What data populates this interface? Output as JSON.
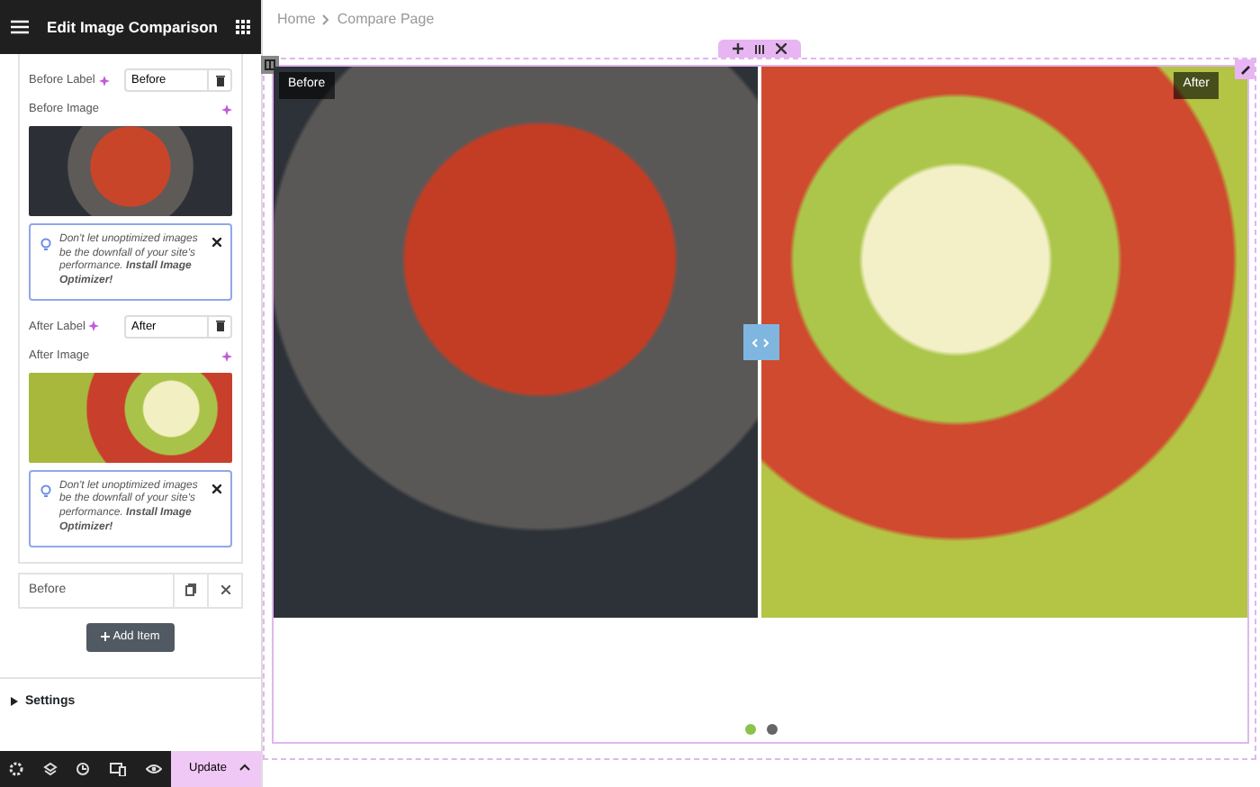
{
  "panel": {
    "title": "Edit Image Comparison",
    "sections": [
      {
        "label_caption": "Before Label",
        "label_value": "Before",
        "image_caption": "Before Image",
        "notice": "Don't let unoptimized images be the downfall of your site's performance. **Install Image Optimizer!**"
      },
      {
        "label_caption": "After Label",
        "label_value": "After",
        "image_caption": "After Image",
        "notice": "Don't let unoptimized images be the downfall of your site's performance. **Install Image Optimizer!**"
      }
    ],
    "collapsed_item": {
      "label": "Before"
    },
    "add_button": "Add Item",
    "settings": {
      "label": "Settings",
      "expanded": false
    },
    "update_button": "Update"
  },
  "canvas": {
    "breadcrumb": [
      "Home",
      "Compare Page"
    ],
    "comparison": {
      "labels": [
        "Before",
        "After"
      ],
      "level": 0.5
    },
    "dots": [
      {
        "selected": true
      },
      {
        "selected": false
      }
    ]
  }
}
